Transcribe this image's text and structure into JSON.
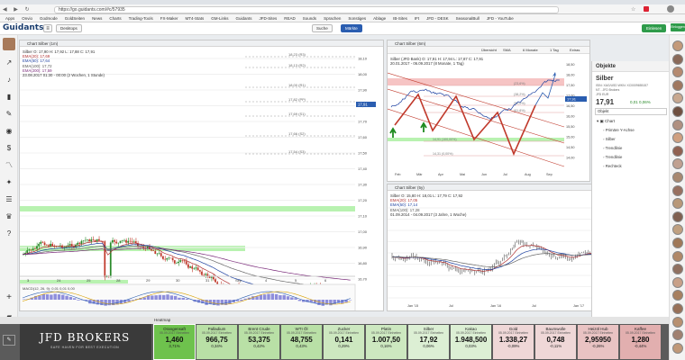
{
  "browser": {
    "url": "https://go.guidants.com/#c/57935",
    "bookmarks": [
      "Apps",
      "Onvio",
      "Godmode",
      "GoldSeiten",
      "News",
      "Charts",
      "Trading-Tools",
      "FX-Maker",
      "MT4-Stats",
      "GM-Links",
      "Guidants",
      "JFD-Sites",
      "READ",
      "Sounds",
      "Sprachen",
      "Sonstiges",
      "Ablage",
      "IB-Sites",
      "IFt",
      "JFD - DESK",
      "SeasonalBull",
      "JFD - YouTube"
    ]
  },
  "app": {
    "logo": "Guidants",
    "tab_dashboard": "Desktops",
    "search_btn": "Suche",
    "markt_btn": "Märkte",
    "top_right_btn": "Einlesen",
    "login_btn": "Einloggen"
  },
  "chart_left": {
    "title": "Chart Silber (1m)",
    "legend": [
      "Silber  O: 17,90  H: 17,92  L: 17,88  C: 17,91",
      "EMA(20): 17,69",
      "EMA(50): 17,64",
      "EMA(100): 17,72",
      "EMA(200): 17,59",
      "23.08.2017 01:30 - 00:00  (2 Wochen, 1 Stunde)"
    ],
    "pivots": [
      "18,23 (R3)",
      "18,13 (R2)",
      "18,00 (R1)",
      "17,82 (PP)",
      "17,69 (S1)",
      "17,66 (S2)",
      "17,54 (S3)"
    ],
    "yticks": [
      "18,10",
      "18,00",
      "17,90",
      "17,80",
      "17,70",
      "17,60",
      "17,50",
      "17,40",
      "17,30",
      "17,20",
      "17,10",
      "17,00",
      "16,90",
      "16,80",
      "16,70"
    ],
    "xticks": [
      "3",
      "24",
      "25",
      "28",
      "29",
      "30",
      "31",
      "Sep",
      "4",
      "5",
      "6"
    ],
    "price_tag": "17,91",
    "osc_legend": "MACD(12, 26, 9): 0,01  0,01  0,00"
  },
  "chart_tr": {
    "title": "Chart Silber (6m)",
    "toolbar": [
      "Übersicht",
      "SMA",
      "6 Monate",
      "1 Tag",
      "Extras"
    ],
    "legend": [
      "Silber (JFD Bank)  O: 17,91  H: 17,94  L: 17,87  C: 17,91",
      "20.01.2017 - 06.09.2017  (8 Monate, 1 Tag)"
    ],
    "xticks": [
      "Feb",
      "Mär",
      "Apr",
      "Mai",
      "Jun",
      "Jul",
      "Aug",
      "Sep"
    ],
    "yticks": [
      "18,50",
      "18,00",
      "17,50",
      "17,00",
      "16,50",
      "16,00",
      "15,50",
      "15,00",
      "14,50",
      "14,00"
    ],
    "fib_labels": [
      "(23,6%)",
      "(38,2%)",
      "(50,0%)",
      "(61,8%)",
      "14,91 (100,00%)",
      "14,31 (0,00%)"
    ],
    "price_tag": "17,91"
  },
  "chart_br": {
    "title": "Chart Silber (5y)",
    "legend": [
      "Silber  O: 15,80  H: 18,01  L: 17,79  C: 17,92",
      "EMA(20): 17,05",
      "EMA(50): 17,14",
      "EMA(100): 17,28",
      "01.09.2014 - 04.09.2017  (3 Jahre, 1 Woche)"
    ],
    "xticks": [
      "Jan '15",
      "Jul",
      "Jan '16",
      "Jul",
      "Jan '17",
      "Jul"
    ],
    "yticks": [
      "22,00",
      "21,00",
      "20,00",
      "19,00",
      "18,00",
      "17,00",
      "16,00",
      "15,00",
      "14,00"
    ],
    "price_tag": "17,91"
  },
  "objekte": {
    "header": "Objekte",
    "name": "Silber",
    "sub1": "ISIN: XAG/USD  WKN: XC0009655157",
    "sub2": "NT - JFD Brokers",
    "sub3": "JFD  EUR",
    "price": "17,91",
    "change": "0,01  0,06%",
    "field_label": "Objekt",
    "tree": [
      "Chart",
      "Primäre Y-Achse",
      "Silber",
      "Trendlinie",
      "Trendlinie",
      "Rechteck"
    ]
  },
  "heatmap": {
    "label": "Heatmap",
    "brand": "JFD BROKERS",
    "slogan": "SAFE HAVEN FOR BEST EXECUTION",
    "tiles": [
      {
        "name": "Orangensaft",
        "date": "05.09.2017 Einheiten",
        "value": "1,460",
        "change": "3,71%",
        "color": "#6ec24d"
      },
      {
        "name": "Palladium",
        "date": "05.09.2017 Einheiten",
        "value": "966,75",
        "change": "0,34%",
        "color": "#b9e0a6"
      },
      {
        "name": "Brent Crude",
        "date": "05.09.2017 Einheiten",
        "value": "53,375",
        "change": "0,42%",
        "color": "#b9e0a6"
      },
      {
        "name": "WTI Öl",
        "date": "05.09.2017 Einheiten",
        "value": "48,755",
        "change": "0,43%",
        "color": "#b9e0a6"
      },
      {
        "name": "Zucker",
        "date": "05.09.2017 Einheiten",
        "value": "0,141",
        "change": "0,29%",
        "color": "#cde8c0"
      },
      {
        "name": "Platin",
        "date": "05.09.2017 Einheiten",
        "value": "1.007,50",
        "change": "0,16%",
        "color": "#cde8c0"
      },
      {
        "name": "Silber",
        "date": "05.09.2017 Einheiten",
        "value": "17,92",
        "change": "0,06%",
        "color": "#dcefd4"
      },
      {
        "name": "Kakao",
        "date": "05.09.2017 Einheiten",
        "value": "1.948,500",
        "change": "0,03%",
        "color": "#dcefd4"
      },
      {
        "name": "Gold",
        "date": "05.09.2017 Einheiten",
        "value": "1.338,27",
        "change": "-0,09%",
        "color": "#efd7d7"
      },
      {
        "name": "Baumwolle",
        "date": "05.09.2017 Einheiten",
        "value": "0,748",
        "change": "-0,11%",
        "color": "#efd7d7"
      },
      {
        "name": "Heizöl Hub",
        "date": "05.09.2017 Einheiten",
        "value": "2,95950",
        "change": "-0,26%",
        "color": "#e9c3c3"
      },
      {
        "name": "Kaffee",
        "date": "05.09.2017 Einheiten",
        "value": "1,280",
        "change": "-0,44%",
        "color": "#e2afaf"
      }
    ]
  },
  "colors": {
    "up": "#2a8a2a",
    "down": "#c0392b",
    "ema_blue": "#1b3fa0",
    "ema_red": "#b03030",
    "zone_green": "#b8f2b0",
    "zone_red": "#f6c4c4"
  }
}
